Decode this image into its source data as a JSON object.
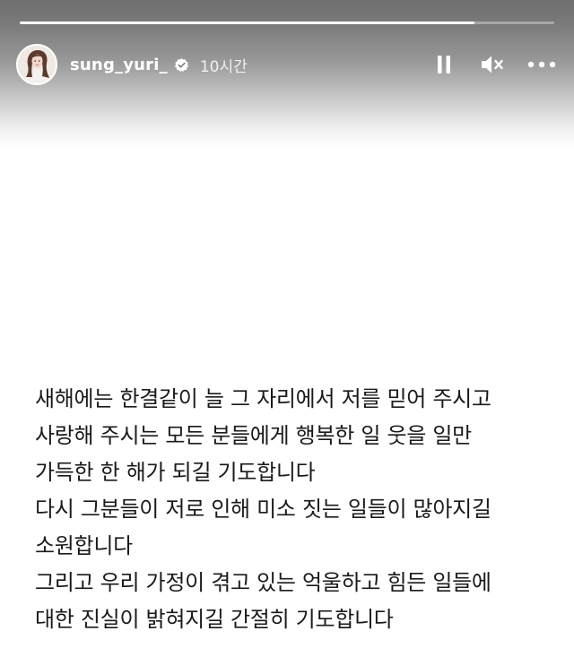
{
  "story": {
    "progress_fraction": 0.85,
    "username": "sung_yuri_",
    "verified": true,
    "posted_time": "10시간",
    "controls": {
      "pause_icon": "pause-icon",
      "mute_icon": "speaker-muted-icon",
      "more_icon": "more-options-icon"
    },
    "caption_lines": [
      "새해에는 한결같이 늘 그 자리에서 저를 믿어 주시고",
      "사랑해 주시는 모든 분들에게 행복한 일 웃을 일만",
      "가득한 한 해가 되길 기도합니다",
      "다시 그분들이 저로 인해 미소 짓는 일들이 많아지길",
      "소원합니다",
      "그리고 우리 가정이 겪고 있는 억울하고 힘든 일들에",
      "대한 진실이 밝혀지길 간절히 기도합니다"
    ],
    "colors": {
      "text": "#1a1a1a",
      "header_text": "#ffffff",
      "background": "#ffffff"
    }
  }
}
